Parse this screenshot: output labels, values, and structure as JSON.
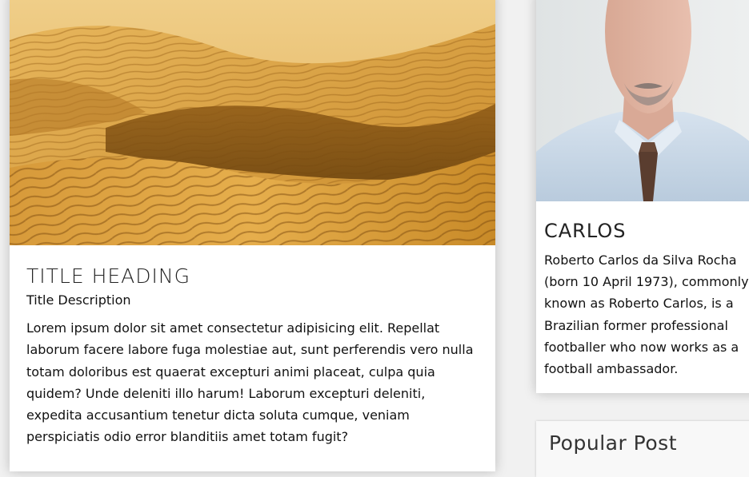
{
  "main_post": {
    "image_alt": "Golden desert sand dunes",
    "title": "TITLE HEADING",
    "description": "Title Description",
    "body": "Lorem ipsum dolor sit amet consectetur adipisicing elit. Repellat laborum facere labore fuga molestiae aut, sunt perferendis vero nulla totam doloribus est quaerat excepturi animi placeat, culpa quia quidem? Unde deleniti illo harum! Laborum excepturi deleniti, expedita accusantium tenetur dicta soluta cumque, veniam perspiciatis odio error blanditiis amet totam fugit?"
  },
  "profile": {
    "image_alt": "Portrait of man in light blue shirt and brown tie",
    "name": "CARLOS",
    "bio": "Roberto Carlos da Silva Rocha (born 10 April 1973), commonly known as Roberto Carlos, is a Brazilian former professional footballer who now works as a football ambassador."
  },
  "popular": {
    "title": "Popular Post"
  },
  "colors": {
    "page_bg": "#f1f1f1",
    "card_bg": "#ffffff",
    "sand_light": "#e3b45a",
    "sand_dark": "#8a5512",
    "shirt": "#c9d9ea"
  }
}
